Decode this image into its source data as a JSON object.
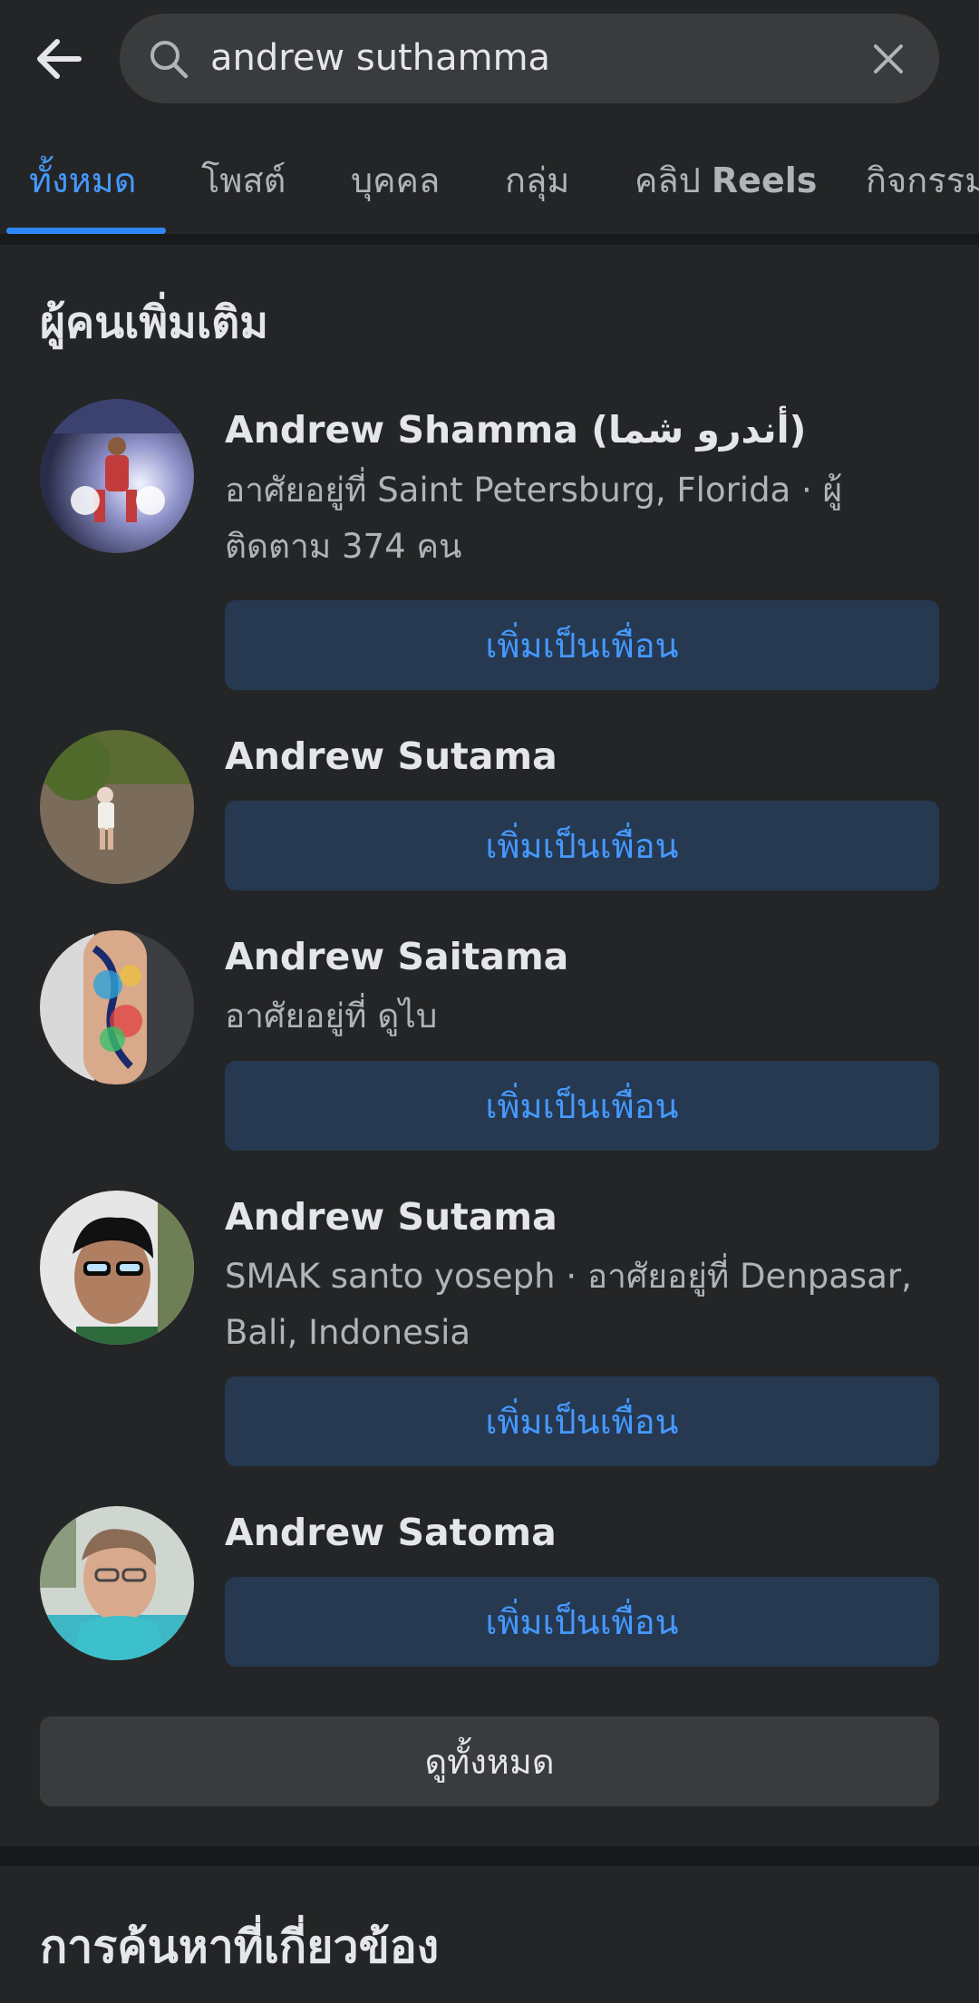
{
  "search": {
    "query": "andrew suthamma"
  },
  "tabs": [
    {
      "label": "ทั้งหมด",
      "active": true
    },
    {
      "label": "โพสต์",
      "active": false
    },
    {
      "label": "บุคคล",
      "active": false
    },
    {
      "label": "กลุ่ม",
      "active": false
    },
    {
      "label_prefix": "คลิป",
      "label_bold": "Reels",
      "active": false
    },
    {
      "label": "กิจกรรม",
      "active": false
    }
  ],
  "section": {
    "title": "ผู้คนเพิ่มเติม"
  },
  "people": [
    {
      "name": "Andrew Shamma (أندرو شما)",
      "meta_line1": "อาศัยอยู่ที่ Saint Petersburg, Florida · ผู้",
      "meta_line2": "ติดตาม 374 คน",
      "button": "เพิ่มเป็นเพื่อน"
    },
    {
      "name": "Andrew Sutama",
      "button": "เพิ่มเป็นเพื่อน"
    },
    {
      "name": "Andrew Saitama",
      "meta_line1": "อาศัยอยู่ที่ ดูไบ",
      "button": "เพิ่มเป็นเพื่อน"
    },
    {
      "name": "Andrew Sutama",
      "meta_line1": "SMAK santo yoseph · อาศัยอยู่ที่ Denpasar,",
      "meta_line2": "Bali, Indonesia",
      "button": "เพิ่มเป็นเพื่อน"
    },
    {
      "name": "Andrew Satoma",
      "button": "เพิ่มเป็นเพื่อน"
    }
  ],
  "see_all": "ดูทั้งหมด",
  "related": {
    "title": "การค้นหาที่เกี่ยวข้อง"
  },
  "icons": {
    "back": "arrow-left-icon",
    "search": "search-icon",
    "clear": "close-icon"
  },
  "colors": {
    "background": "#242526",
    "accent": "#4599ff",
    "button_bg": "#263951",
    "secondary_text": "#b0b3b8"
  }
}
